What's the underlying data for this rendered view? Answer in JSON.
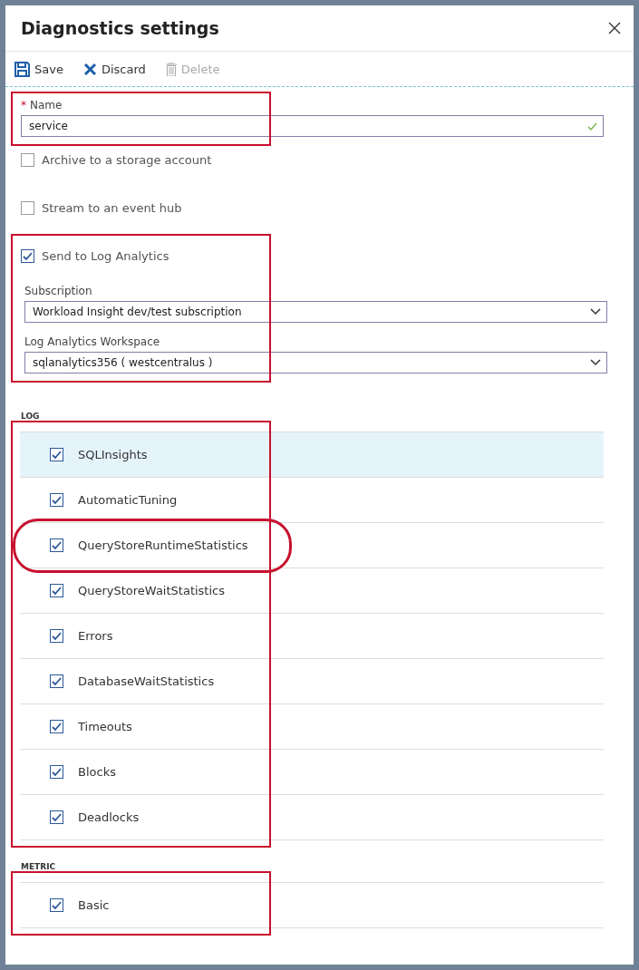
{
  "window": {
    "title": "Diagnostics settings"
  },
  "toolbar": [
    {
      "kind": "save",
      "label": "Save",
      "disabled": false
    },
    {
      "kind": "discard",
      "label": "Discard",
      "disabled": false
    },
    {
      "kind": "delete",
      "label": "Delete",
      "disabled": true
    }
  ],
  "name_field": {
    "label": "Name",
    "required": true,
    "required_mark": "*",
    "value": "service",
    "valid": true,
    "annotated": true
  },
  "destinations": [
    {
      "label": "Archive to a storage account",
      "checked": false
    },
    {
      "label": "Stream to an event hub",
      "checked": false
    }
  ],
  "log_analytics": {
    "label": "Send to Log Analytics",
    "checked": true,
    "annotated": true,
    "subscription": {
      "label": "Subscription",
      "value": "Workload Insight dev/test subscription"
    },
    "workspace": {
      "label": "Log Analytics Workspace",
      "value": "sqlanalytics356 ( westcentralus )"
    }
  },
  "log": {
    "heading": "LOG",
    "annotated": true,
    "items": [
      {
        "label": "SQLInsights",
        "checked": true,
        "selected": true,
        "circled": false
      },
      {
        "label": "AutomaticTuning",
        "checked": true,
        "selected": false,
        "circled": false
      },
      {
        "label": "QueryStoreRuntimeStatistics",
        "checked": true,
        "selected": false,
        "circled": true
      },
      {
        "label": "QueryStoreWaitStatistics",
        "checked": true,
        "selected": false,
        "circled": false
      },
      {
        "label": "Errors",
        "checked": true,
        "selected": false,
        "circled": false
      },
      {
        "label": "DatabaseWaitStatistics",
        "checked": true,
        "selected": false,
        "circled": false
      },
      {
        "label": "Timeouts",
        "checked": true,
        "selected": false,
        "circled": false
      },
      {
        "label": "Blocks",
        "checked": true,
        "selected": false,
        "circled": false
      },
      {
        "label": "Deadlocks",
        "checked": true,
        "selected": false,
        "circled": false
      }
    ]
  },
  "metric": {
    "heading": "METRIC",
    "annotated": true,
    "items": [
      {
        "label": "Basic",
        "checked": true,
        "selected": false,
        "circled": false
      }
    ]
  }
}
